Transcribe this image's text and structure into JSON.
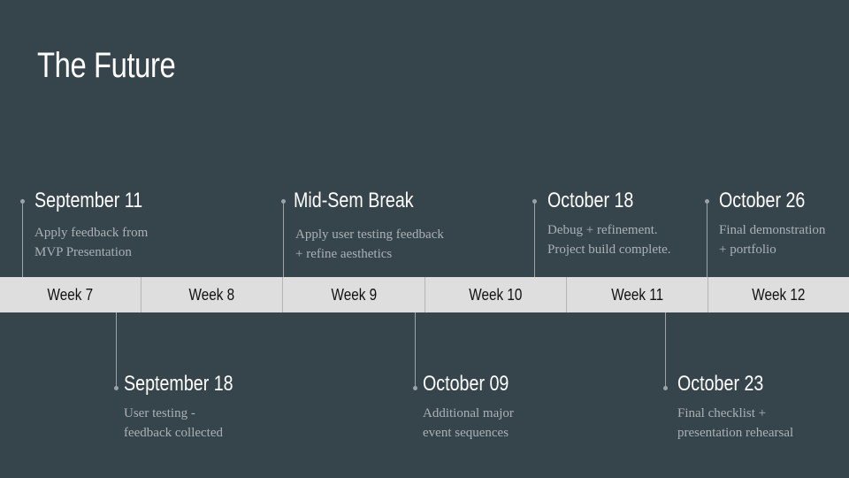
{
  "title": "The Future",
  "weeks": [
    "Week 7",
    "Week 8",
    "Week 9",
    "Week 10",
    "Week 11",
    "Week 12"
  ],
  "events_top": [
    {
      "date": "September 11",
      "desc1": "Apply feedback from",
      "desc2": "MVP Presentation"
    },
    {
      "date": "Mid-Sem Break",
      "desc1": "Apply user testing feedback",
      "desc2": "+ refine aesthetics"
    },
    {
      "date": "October 18",
      "desc1": "Debug + refinement.",
      "desc2": "Project build complete."
    },
    {
      "date": "October 26",
      "desc1": "Final demonstration",
      "desc2": "+ portfolio"
    }
  ],
  "events_bottom": [
    {
      "date": "September 18",
      "desc1": "User testing -",
      "desc2": "feedback collected"
    },
    {
      "date": "October 09",
      "desc1": "Additional major",
      "desc2": "event sequences"
    },
    {
      "date": "October 23",
      "desc1": "Final checklist +",
      "desc2": "presentation rehearsal"
    }
  ]
}
